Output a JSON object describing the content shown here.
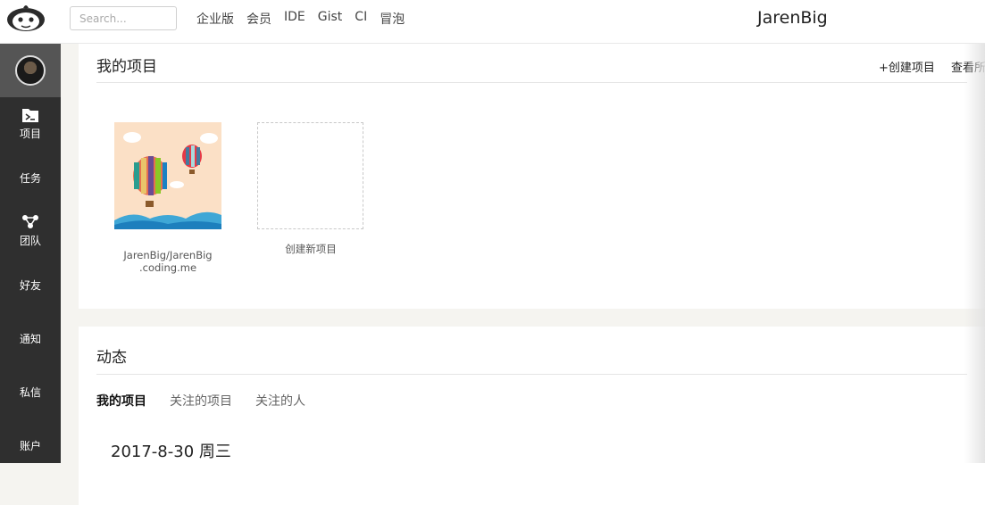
{
  "header": {
    "search_placeholder": "Search...",
    "nav": [
      "企业版",
      "会员",
      "IDE",
      "Gist",
      "CI",
      "冒泡"
    ],
    "username": "JarenBig"
  },
  "sidebar": {
    "items": [
      {
        "label": "项目",
        "icon": "folder-icon"
      },
      {
        "label": "任务",
        "icon": ""
      },
      {
        "label": "团队",
        "icon": "team-icon"
      },
      {
        "label": "好友",
        "icon": ""
      },
      {
        "label": "通知",
        "icon": ""
      },
      {
        "label": "私信",
        "icon": ""
      },
      {
        "label": "账户",
        "icon": ""
      }
    ]
  },
  "my_projects": {
    "title": "我的项目",
    "create_link": "+创建项目",
    "view_all_link": "查看所",
    "projects": [
      {
        "name_line1": "JarenBig/JarenBig",
        "name_line2": ".coding.me"
      }
    ],
    "new_project_label": "创建新项目"
  },
  "activity": {
    "title": "动态",
    "tabs": [
      "我的项目",
      "关注的项目",
      "关注的人"
    ],
    "active_tab": "我的项目",
    "date": "2017-8-30 周三"
  },
  "colors": {
    "sidebar_bg": "#2f2f2f",
    "sidebar_active_bg": "#555555",
    "page_bg": "#f5f4f0"
  }
}
